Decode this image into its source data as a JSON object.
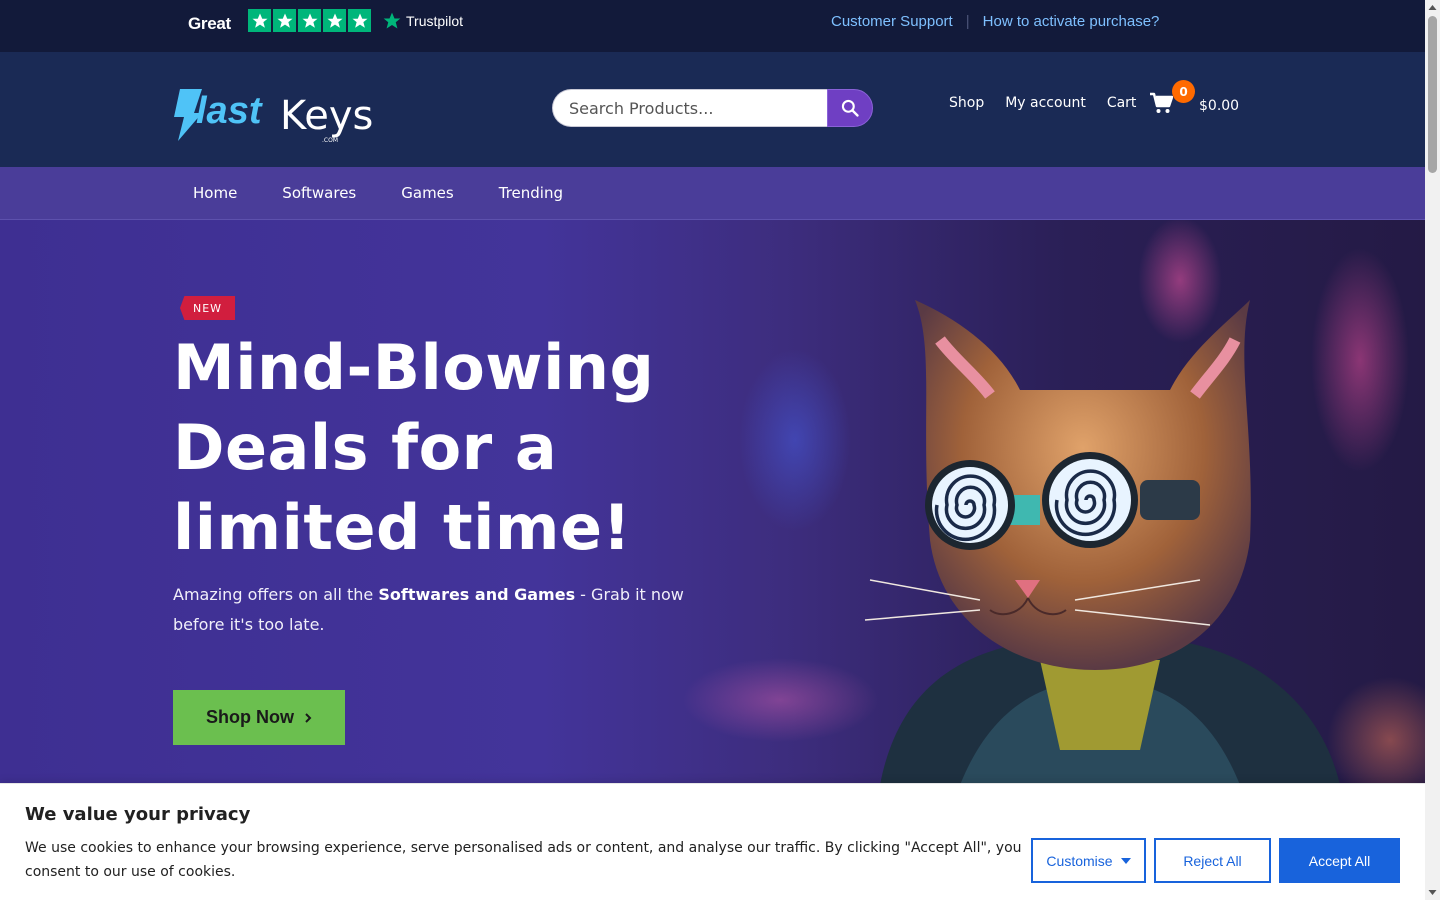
{
  "topbar": {
    "trustpilot_rating": "Great",
    "trustpilot_brand": "Trustpilot",
    "stars": 5,
    "links": [
      "Customer Support",
      "How to activate purchase?"
    ]
  },
  "header": {
    "logo_text": "BlastKeys",
    "logo_sub": ".COM",
    "search": {
      "placeholder": "Search Products..."
    },
    "nav": [
      "Shop",
      "My account",
      "Cart"
    ],
    "cart_count": "0",
    "cart_total": "$0.00"
  },
  "category_nav": [
    "Home",
    "Softwares",
    "Games",
    "Trending"
  ],
  "hero": {
    "badge": "NEW",
    "title": "Mind-Blowing Deals for a limited time!",
    "subtitle_pre": "Amazing offers on all the ",
    "subtitle_bold": "Softwares and Games",
    "subtitle_post": " - Grab it now before it's too late.",
    "cta": "Shop Now"
  },
  "cookie_banner": {
    "title": "We value your privacy",
    "text": "We use cookies to enhance your browsing experience, serve personalised ads or content, and analyse our traffic. By clicking \"Accept All\", you consent to our use of cookies.",
    "buttons": {
      "customise": "Customise",
      "reject": "Reject All",
      "accept": "Accept All"
    }
  },
  "colors": {
    "topbar_bg": "#121a3a",
    "header_bg": "#1a2a55",
    "catnav_bg": "#4a3d99",
    "accent_purple": "#6f3fc3",
    "cta_green": "#6bbf4f",
    "trustpilot_green": "#00b67a",
    "cookie_blue": "#1863dc",
    "badge_red": "#d11e3e",
    "cart_badge_orange": "#ff6a00"
  }
}
